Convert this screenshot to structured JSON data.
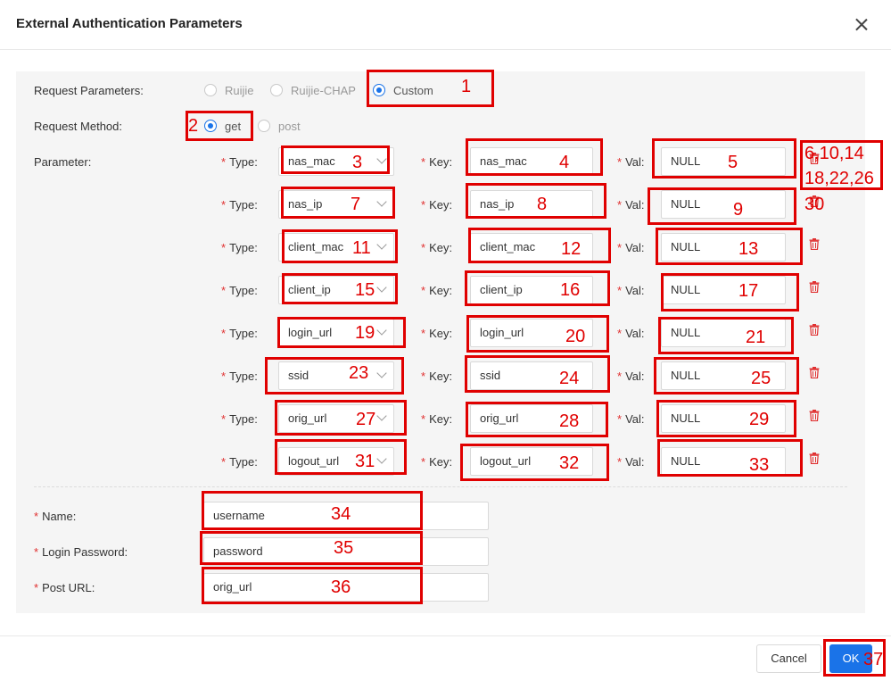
{
  "dialog": {
    "title": "External Authentication Parameters"
  },
  "request_parameters": {
    "label": "Request Parameters:",
    "options": [
      "Ruijie",
      "Ruijie-CHAP",
      "Custom"
    ],
    "selected": "Custom"
  },
  "request_method": {
    "label": "Request Method:",
    "options": [
      "get",
      "post"
    ],
    "selected": "get"
  },
  "parameter_label": "Parameter:",
  "row_labels": {
    "type": "Type:",
    "key": "Key:",
    "val": "Val:",
    "required_mark": "*"
  },
  "params": [
    {
      "type": "nas_mac",
      "key": "nas_mac",
      "val": "NULL"
    },
    {
      "type": "nas_ip",
      "key": "nas_ip",
      "val": "NULL"
    },
    {
      "type": "client_mac",
      "key": "client_mac",
      "val": "NULL"
    },
    {
      "type": "client_ip",
      "key": "client_ip",
      "val": "NULL"
    },
    {
      "type": "login_url",
      "key": "login_url",
      "val": "NULL"
    },
    {
      "type": "ssid",
      "key": "ssid",
      "val": "NULL"
    },
    {
      "type": "orig_url",
      "key": "orig_url",
      "val": "NULL"
    },
    {
      "type": "logout_url",
      "key": "logout_url",
      "val": "NULL"
    }
  ],
  "fields": [
    {
      "label": "Name:",
      "value": "username"
    },
    {
      "label": "Login Password:",
      "value": "password"
    },
    {
      "label": "Post URL:",
      "value": "orig_url"
    }
  ],
  "footer": {
    "cancel": "Cancel",
    "ok": "OK"
  },
  "annotations": [
    "1",
    "2",
    "3",
    "4",
    "5",
    "6,10,14",
    "18,22,26",
    "7",
    "8",
    "9",
    "30",
    "11",
    "12",
    "13",
    "15",
    "16",
    "17",
    "19",
    "20",
    "21",
    "23",
    "24",
    "25",
    "27",
    "28",
    "29",
    "31",
    "32",
    "33",
    "34",
    "35",
    "36",
    "37"
  ],
  "colors": {
    "primary": "#1a73e8",
    "annotation": "#e00000",
    "required": "#e03030",
    "panel": "#f5f5f5"
  },
  "icons": {
    "close": "close-icon",
    "delete": "trash-icon",
    "dropdown": "chevron-down-icon"
  }
}
